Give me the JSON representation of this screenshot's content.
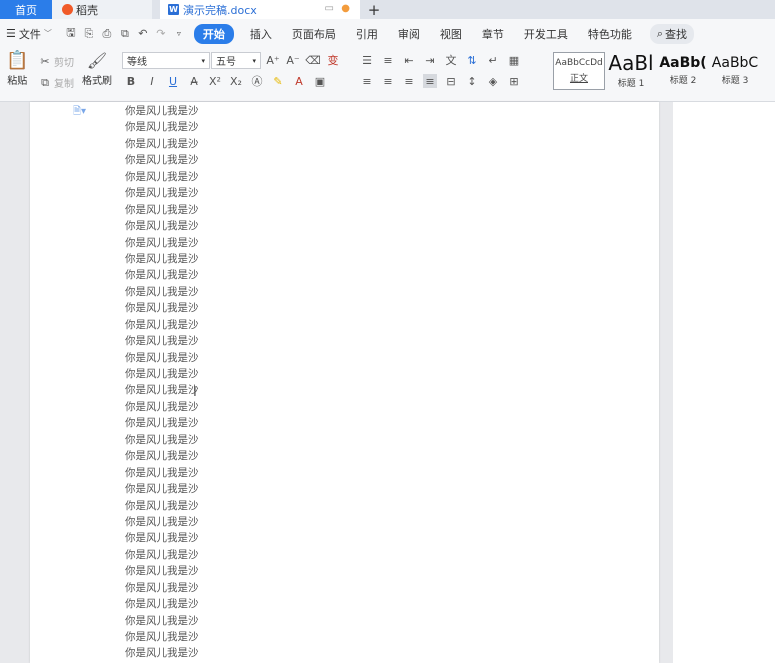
{
  "tabs": {
    "home": "首页",
    "daoke": "稻壳",
    "document": "演示完稿.docx",
    "plus": "+"
  },
  "menu": {
    "file": "文件",
    "items": [
      "开始",
      "插入",
      "页面布局",
      "引用",
      "审阅",
      "视图",
      "章节",
      "开发工具",
      "特色功能"
    ],
    "search": "查找"
  },
  "ribbon": {
    "paste": "粘贴",
    "cut": "剪切",
    "copy": "复制",
    "format_painter": "格式刷",
    "font_name": "等线",
    "font_size": "五号",
    "styles": [
      {
        "preview": "AaBbCcDd",
        "label": "正文"
      },
      {
        "preview": "AaBl",
        "label": "标题 1"
      },
      {
        "preview": "AaBb(",
        "label": "标题 2"
      },
      {
        "preview": "AaBbC",
        "label": "标题 3"
      }
    ]
  },
  "document": {
    "lines": [
      "你是风儿我是沙",
      "你是风儿我是沙",
      "你是风儿我是沙",
      "你是风儿我是沙",
      "你是风儿我是沙",
      "你是风儿我是沙",
      "你是风儿我是沙",
      "你是风儿我是沙",
      "你是风儿我是沙",
      "你是风儿我是沙",
      "你是风儿我是沙",
      "你是风儿我是沙",
      "你是风儿我是沙",
      "你是风儿我是沙",
      "你是风儿我是沙",
      "你是风儿我是沙",
      "你是风儿我是沙",
      "你是风儿我是沙",
      "你是风儿我是沙",
      "你是风儿我是沙",
      "你是风儿我是沙",
      "你是风儿我是沙",
      "你是风儿我是沙",
      "你是风儿我是沙",
      "你是风儿我是沙",
      "你是风儿我是沙",
      "你是风儿我是沙",
      "你是风儿我是沙",
      "你是风儿我是沙",
      "你是风儿我是沙",
      "你是风儿我是沙",
      "你是风儿我是沙",
      "你是风儿我是沙",
      "你是风儿我是沙"
    ]
  },
  "colors": {
    "accent": "#2b7de9",
    "tab_bar": "#dfe3ea",
    "toolbar": "#f6f7f9",
    "workspace": "#e8e9ec"
  }
}
